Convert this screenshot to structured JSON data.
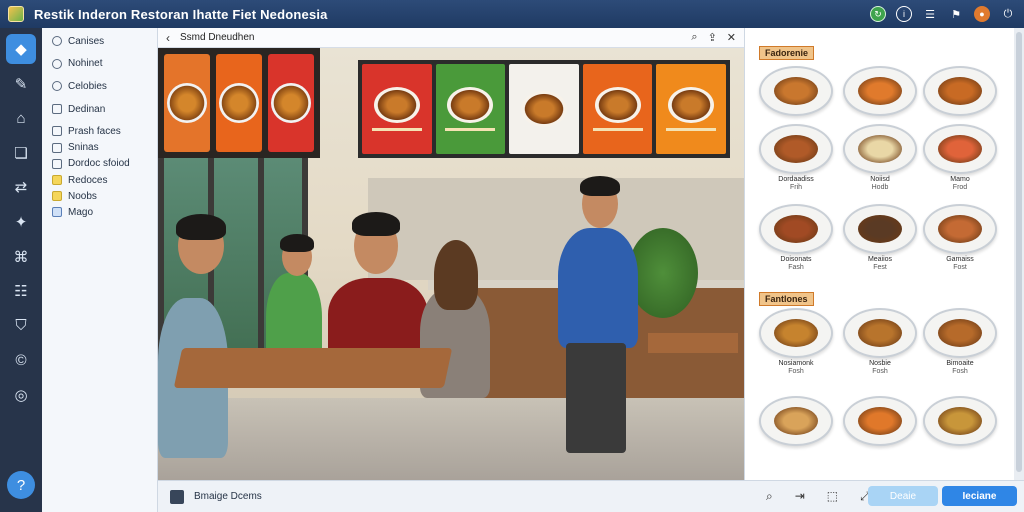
{
  "window": {
    "title": "Restik Inderon Restoran Ihatte Fiet Nedonesia",
    "icons": [
      "refresh-icon",
      "info-icon",
      "menu-icon",
      "bookmark-icon",
      "user-avatar-icon",
      "power-icon"
    ]
  },
  "rail": {
    "items": [
      "home-icon",
      "pin-icon",
      "document-icon",
      "bag-icon",
      "share-icon",
      "bulb-icon",
      "chart-icon",
      "calendar-icon",
      "shield-icon",
      "clock-icon",
      "gamepad-icon"
    ]
  },
  "sidebar": {
    "items": [
      {
        "label": "Canises"
      },
      {
        "label": "Nohinet"
      },
      {
        "label": "Celobies"
      },
      {
        "label": "Dedinan"
      },
      {
        "label": "Prash faces"
      },
      {
        "label": "Sninas"
      },
      {
        "label": "Dordoc sfoiod"
      },
      {
        "label": "Redoces"
      },
      {
        "label": "Noobs"
      },
      {
        "label": "Mago"
      }
    ]
  },
  "main": {
    "breadcrumb": "Ssmd Dneudhen"
  },
  "scene": {
    "menu_colors": [
      "#d9342b",
      "#4a9a3a",
      "#f3f1ec",
      "#e8651c",
      "#f08a1c"
    ]
  },
  "right_panel": {
    "section1": "Fadorenie",
    "section2": "Fantlones",
    "dishes": [
      {
        "name": "",
        "price": "",
        "color": "#c9772e"
      },
      {
        "name": "",
        "price": "",
        "color": "#e07a2c"
      },
      {
        "name": "",
        "price": "",
        "color": "#c86a24"
      },
      {
        "name": "",
        "price": "",
        "color": "#b05a28"
      },
      {
        "name": "",
        "price": "",
        "color": "#e9d7a6"
      },
      {
        "name": "",
        "price": "",
        "color": "#e0633a"
      },
      {
        "name": "Dordaadiss",
        "price": "Frih",
        "color": "#a14a24"
      },
      {
        "name": "Noiisd",
        "price": "Hodb",
        "color": "#5a3a24"
      },
      {
        "name": "Mamo",
        "price": "Frod",
        "color": "#c46a34"
      },
      {
        "name": "Doisonats",
        "price": "Fash",
        "color": "#c6832e"
      },
      {
        "name": "Meaiios",
        "price": "Fest",
        "color": "#b8742c"
      },
      {
        "name": "Gamaiss",
        "price": "Fost",
        "color": "#b66a2a"
      },
      {
        "name": "Nosiamonk",
        "price": "Fosh",
        "color": "#c9883c"
      },
      {
        "name": "Nosbie",
        "price": "Fosh",
        "color": "#e08a2a"
      },
      {
        "name": "Bimoaite",
        "price": "Fosh",
        "color": "#d86a32"
      },
      {
        "name": "",
        "price": "",
        "color": "#d9a35a"
      },
      {
        "name": "",
        "price": "",
        "color": "#e0782a"
      },
      {
        "name": "",
        "price": "",
        "color": "#c8963a"
      }
    ]
  },
  "status": {
    "text": "Bmaige Dcems",
    "secondary_button": "Deaie",
    "primary_button": "Ieciane",
    "icons": [
      "search-icon",
      "share-icon",
      "crop-icon",
      "expand-icon"
    ]
  }
}
